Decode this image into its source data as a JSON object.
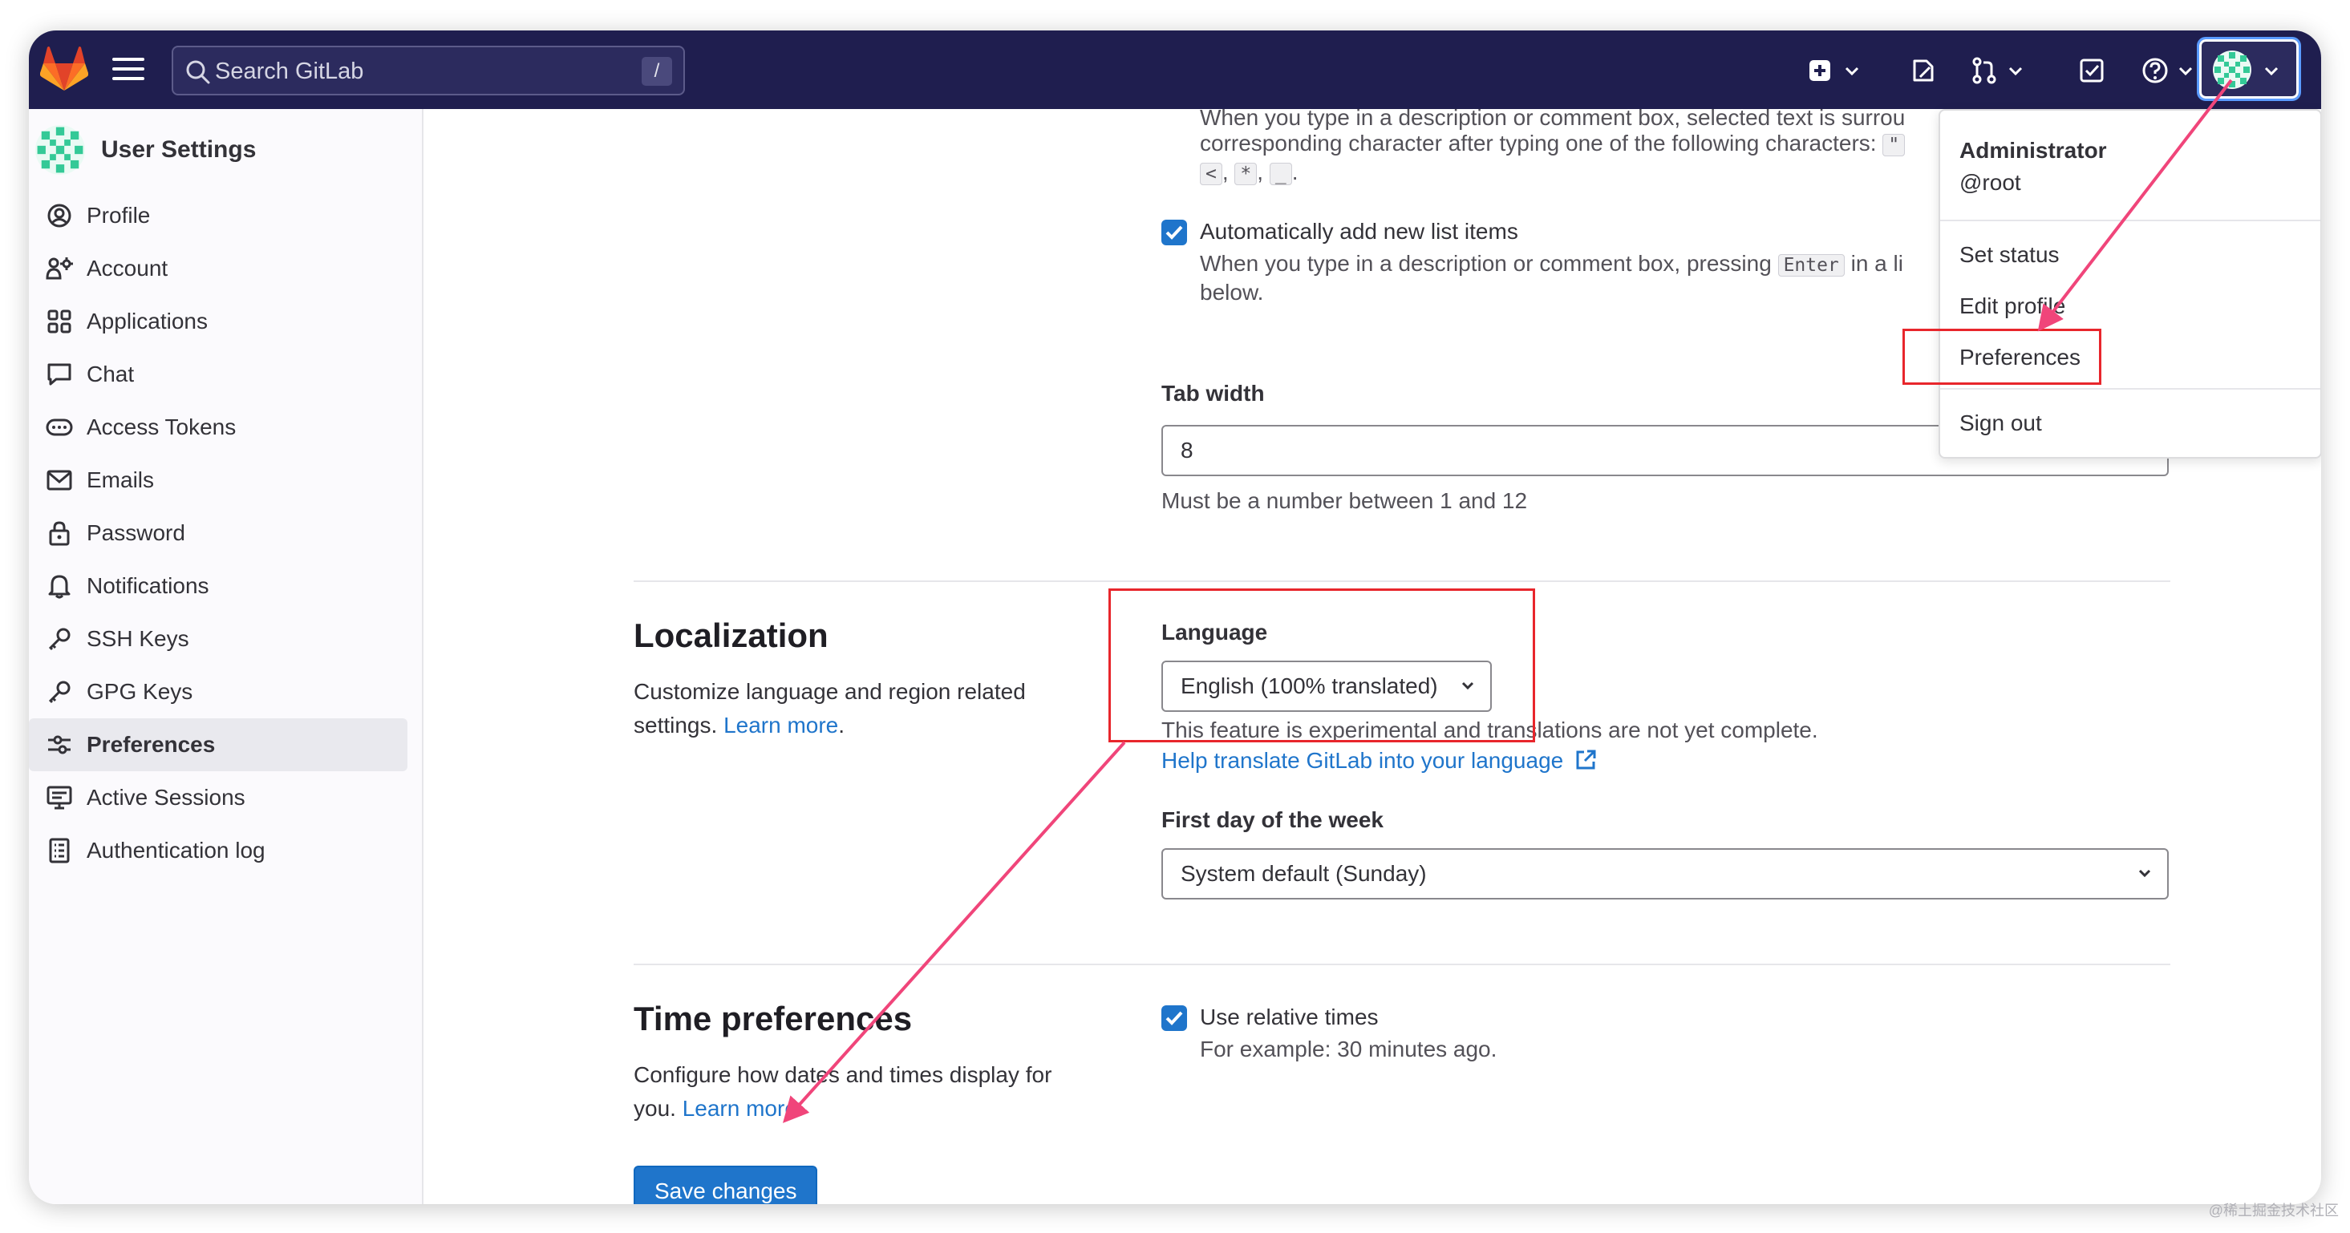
{
  "topbar": {
    "search_placeholder": "Search GitLab",
    "search_shortcut": "/",
    "icons": [
      "plus-square-icon",
      "issues-icon",
      "merge-request-icon",
      "todo-icon",
      "help-icon",
      "avatar"
    ]
  },
  "sidebar": {
    "title": "User Settings",
    "items": [
      {
        "label": "Profile",
        "icon": "profile-icon"
      },
      {
        "label": "Account",
        "icon": "account-icon"
      },
      {
        "label": "Applications",
        "icon": "applications-icon"
      },
      {
        "label": "Chat",
        "icon": "chat-icon"
      },
      {
        "label": "Access Tokens",
        "icon": "token-icon"
      },
      {
        "label": "Emails",
        "icon": "email-icon"
      },
      {
        "label": "Password",
        "icon": "lock-icon"
      },
      {
        "label": "Notifications",
        "icon": "bell-icon"
      },
      {
        "label": "SSH Keys",
        "icon": "key-icon"
      },
      {
        "label": "GPG Keys",
        "icon": "key-icon"
      },
      {
        "label": "Preferences",
        "icon": "preferences-icon",
        "active": true
      },
      {
        "label": "Active Sessions",
        "icon": "monitor-icon"
      },
      {
        "label": "Authentication log",
        "icon": "log-icon"
      }
    ]
  },
  "behavior": {
    "surround_line1": "When you type in a description or comment box, selected text is surrou",
    "surround_line2": "corresponding character after typing one of the following characters:",
    "surround_quote": "\"",
    "surround_chars": [
      "<",
      "*",
      "_"
    ],
    "auto_list_label": "Automatically add new list items",
    "auto_list_desc_before": "When you type in a description or comment box, pressing",
    "auto_list_key": "Enter",
    "auto_list_desc_after": "in a li",
    "auto_list_desc_line2": "below.",
    "tab_width_label": "Tab width",
    "tab_width_value": "8",
    "tab_width_help": "Must be a number between 1 and 12"
  },
  "localization": {
    "heading": "Localization",
    "desc_line1": "Customize language and region related",
    "desc_line2": "settings.",
    "learn_more": "Learn more",
    "language_label": "Language",
    "language_value": "English (100% translated)",
    "language_help": "This feature is experimental and translations are not yet complete.",
    "translate_link": "Help translate GitLab into your language",
    "first_day_label": "First day of the week",
    "first_day_value": "System default (Sunday)"
  },
  "time": {
    "heading": "Time preferences",
    "desc_line1": "Configure how dates and times display for",
    "desc_line2": "you.",
    "learn_more": "Learn more",
    "relative_label": "Use relative times",
    "relative_example": "For example: 30 minutes ago.",
    "save_button": "Save changes"
  },
  "user_menu": {
    "name": "Administrator",
    "username": "@root",
    "items": [
      "Set status",
      "Edit profile",
      "Preferences",
      "Sign out"
    ]
  },
  "annotations": {
    "highlight_color": "#e8262c",
    "arrow_color": "#f0457a"
  },
  "watermark": "@稀土掘金技术社区"
}
